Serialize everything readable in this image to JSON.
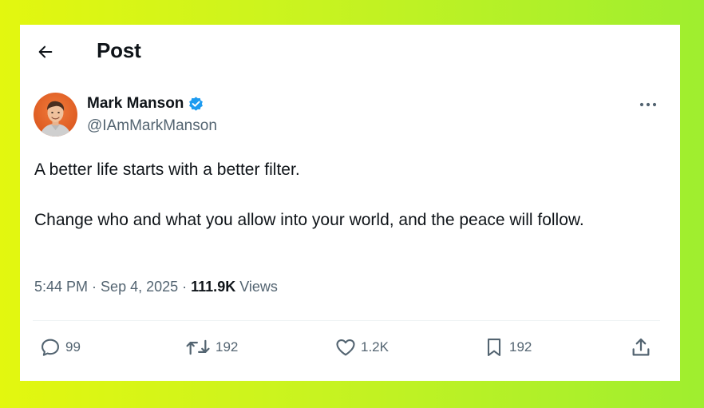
{
  "header": {
    "title": "Post",
    "back_icon": "arrow-left-icon"
  },
  "author": {
    "display_name": "Mark Manson",
    "handle": "@IAmMarkManson",
    "verified": true,
    "verified_color": "#1d9bf0"
  },
  "tweet": {
    "line1": "A better life starts with a better filter.",
    "line2": "Change who and what you allow into your world, and the peace will follow."
  },
  "meta": {
    "time": "5:44 PM",
    "separator1": " · ",
    "date": "Sep 4, 2025",
    "separator2": " · ",
    "views_count": "111.9K",
    "views_label": " Views"
  },
  "actions": {
    "replies": "99",
    "reposts": "192",
    "likes": "1.2K",
    "bookmarks": "192"
  },
  "colors": {
    "text_primary": "#0f1419",
    "text_secondary": "#536471",
    "accent": "#1d9bf0",
    "background_gradient_start": "#e3f70f",
    "background_gradient_end": "#9fee2f"
  }
}
